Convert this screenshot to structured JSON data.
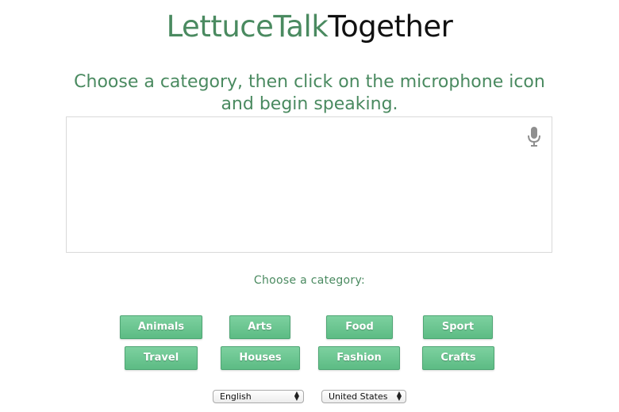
{
  "logo": {
    "part1": "LettuceTalk",
    "part2": "Together"
  },
  "instruction": "Choose a category, then click on the microphone icon and begin speaking.",
  "speech_box": {
    "text": "",
    "mic_icon": "microphone-icon"
  },
  "category_prompt": "Choose a category:",
  "categories": [
    "Animals",
    "Arts",
    "Food",
    "Sport",
    "Travel",
    "Houses",
    "Fashion",
    "Crafts"
  ],
  "language_select": {
    "value": "English"
  },
  "region_select": {
    "value": "United States"
  },
  "colors": {
    "brand_green": "#4a8a60",
    "button_green": "#6cc792"
  }
}
